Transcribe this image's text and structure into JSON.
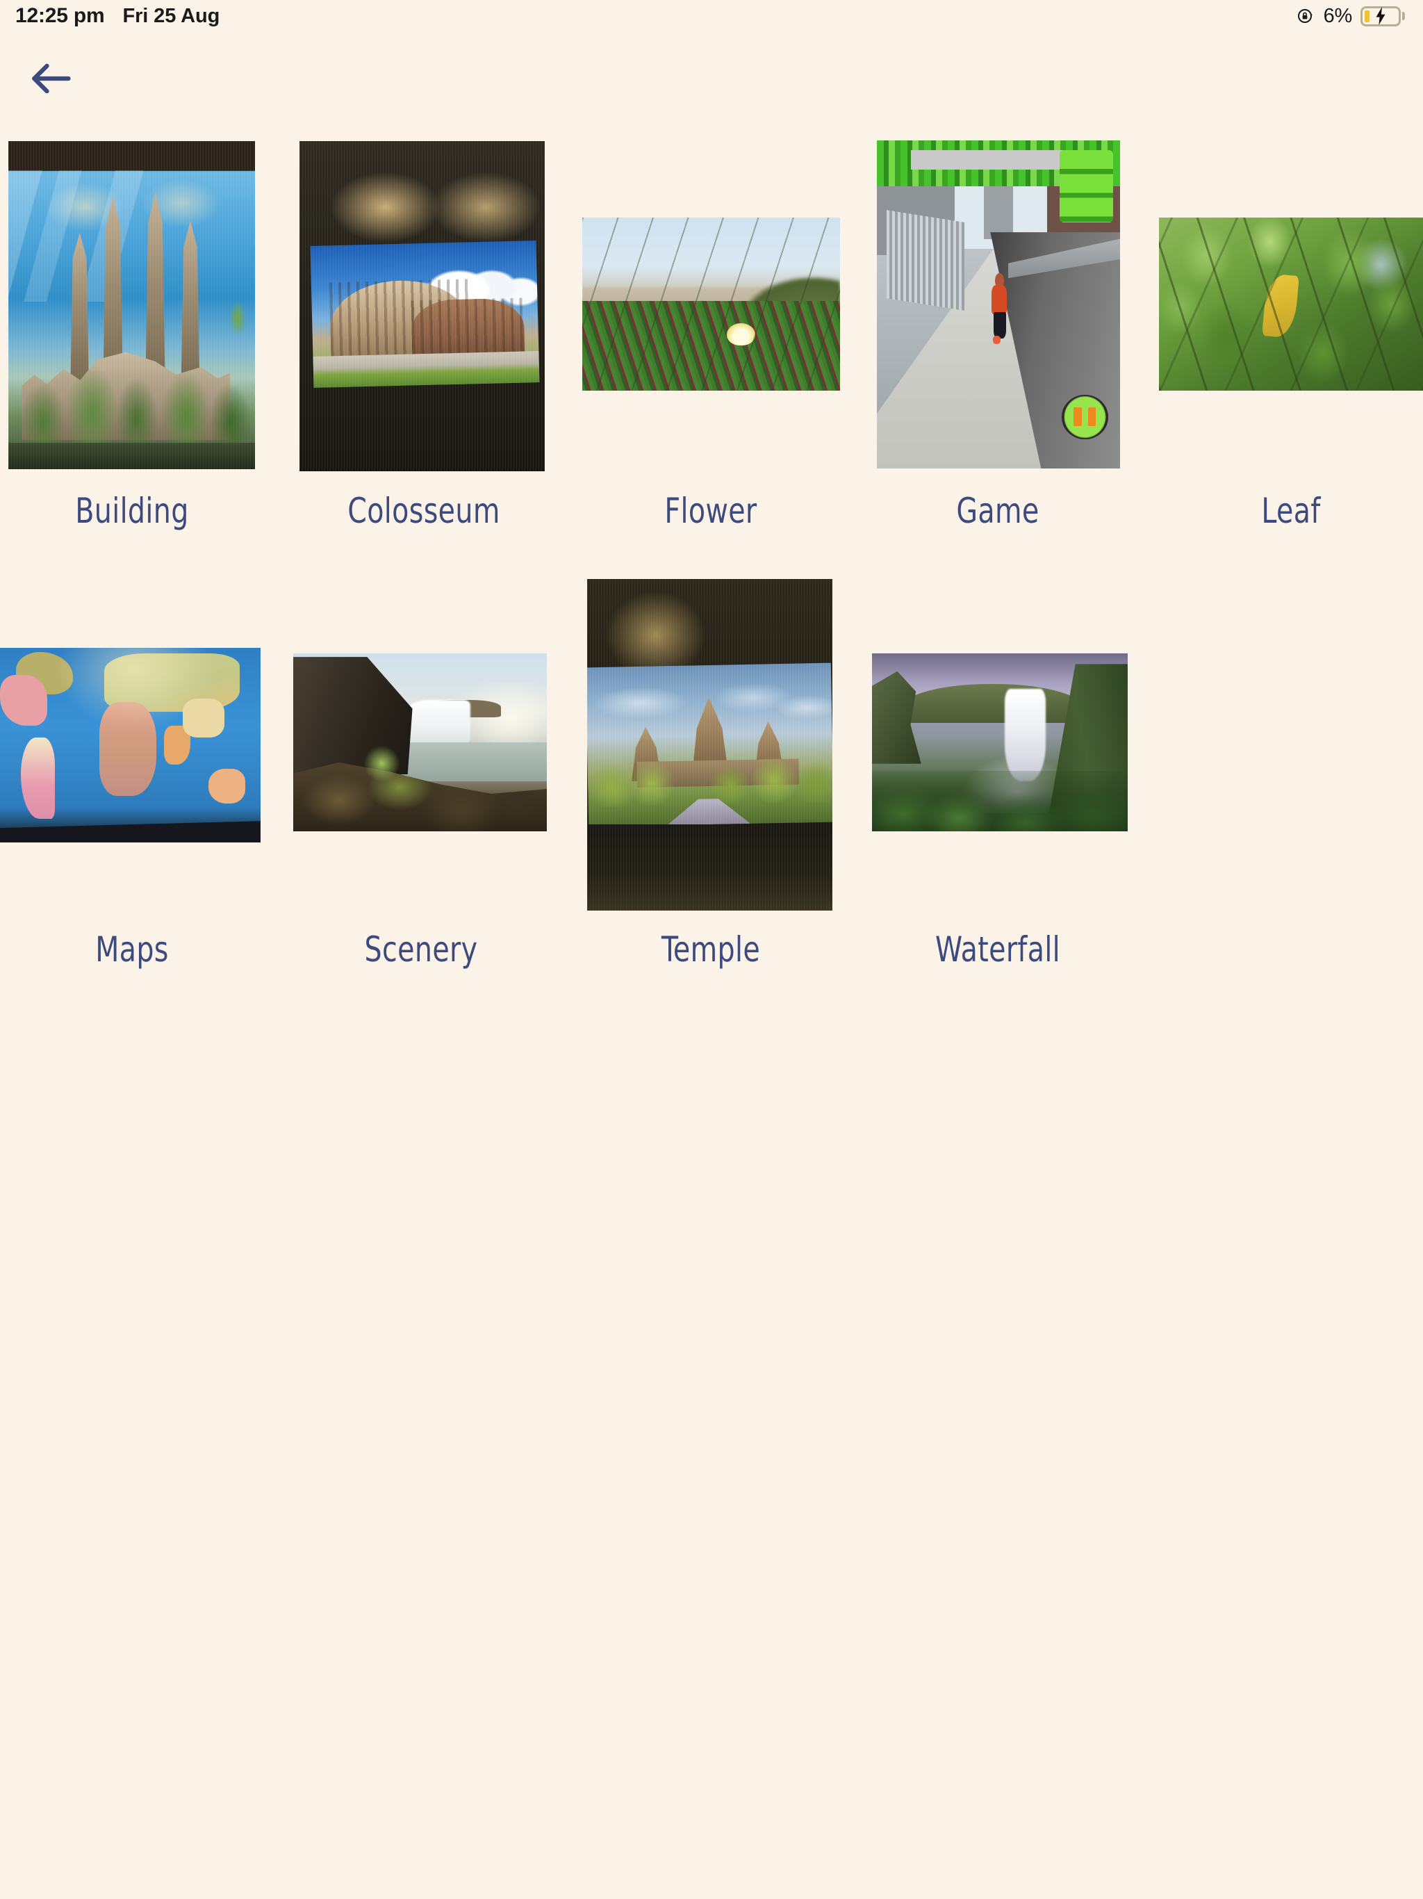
{
  "status_bar": {
    "time": "12:25 pm",
    "date": "Fri 25 Aug",
    "battery_percent": "6%",
    "rotation_lock_icon": "rotation-lock-icon",
    "battery_icon": "battery-charging-icon"
  },
  "nav": {
    "back_icon": "back-arrow-icon"
  },
  "colors": {
    "background": "#fcf3e8",
    "label_text": "#3d4a7d",
    "back_arrow": "#3d4a7d",
    "status_text": "#1a1a1a",
    "battery_fill": "#f0c23a"
  },
  "gallery": {
    "albums": [
      {
        "label": "Building",
        "thumb": "sagrada-familia-thumbnail"
      },
      {
        "label": "Colosseum",
        "thumb": "colosseum-thumbnail"
      },
      {
        "label": "Flower",
        "thumb": "ice-plant-flower-thumbnail"
      },
      {
        "label": "Game",
        "thumb": "endless-runner-game-thumbnail"
      },
      {
        "label": "Leaf",
        "thumb": "yellow-leaf-foliage-thumbnail"
      },
      {
        "label": "Maps",
        "thumb": "world-map-thumbnail"
      },
      {
        "label": "Scenery",
        "thumb": "waterfall-scenery-thumbnail"
      },
      {
        "label": "Temple",
        "thumb": "angkor-wat-temple-thumbnail"
      },
      {
        "label": "Waterfall",
        "thumb": "skogafoss-waterfall-thumbnail"
      }
    ]
  }
}
